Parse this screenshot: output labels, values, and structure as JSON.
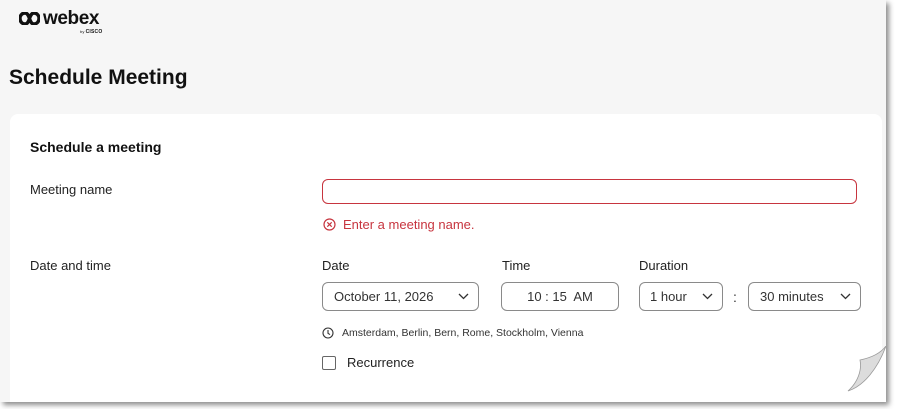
{
  "brand": {
    "name": "webex",
    "by": "by",
    "sub": "CISCO"
  },
  "page": {
    "title": "Schedule Meeting"
  },
  "form": {
    "section_title": "Schedule a meeting",
    "meeting_name": {
      "label": "Meeting name",
      "value": "",
      "placeholder": "",
      "error": "Enter a meeting name."
    },
    "date_time": {
      "label": "Date and time",
      "date_label": "Date",
      "date_value": "October 11, 2026",
      "time_label": "Time",
      "time_value": "10 : 15  AM",
      "duration_label": "Duration",
      "duration_hours": "1 hour",
      "duration_separator": ":",
      "duration_minutes": "30 minutes",
      "timezone": "Amsterdam, Berlin, Bern, Rome, Stockholm, Vienna"
    },
    "recurrence": {
      "label": "Recurrence",
      "checked": false
    }
  },
  "colors": {
    "error": "#c7353f",
    "page_bg": "#f6f6f6",
    "card_bg": "#ffffff"
  },
  "icons": [
    "webex-logo-icon",
    "error-circle-icon",
    "chevron-down-icon",
    "clock-icon"
  ]
}
